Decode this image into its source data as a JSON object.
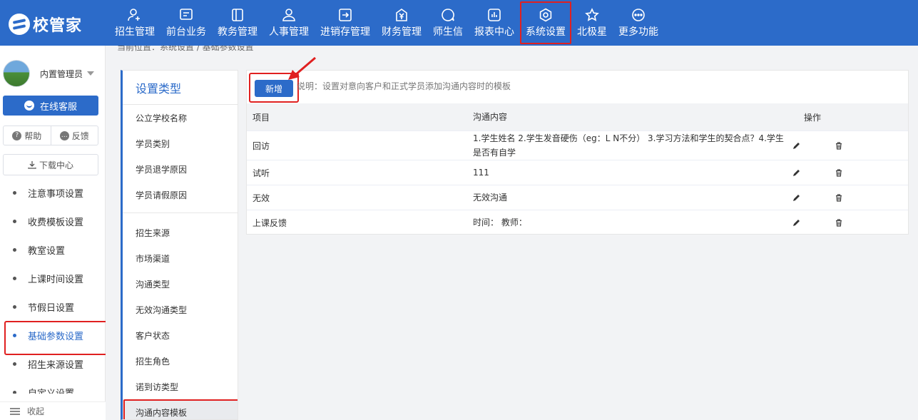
{
  "app": {
    "logo_text": "校管家"
  },
  "nav": [
    {
      "label": "招生管理",
      "icon": "add-user-icon"
    },
    {
      "label": "前台业务",
      "icon": "monitor-icon"
    },
    {
      "label": "教务管理",
      "icon": "book-icon"
    },
    {
      "label": "人事管理",
      "icon": "person-icon"
    },
    {
      "label": "进销存管理",
      "icon": "inventory-icon"
    },
    {
      "label": "财务管理",
      "icon": "yuan-icon"
    },
    {
      "label": "师生信",
      "icon": "chat-icon"
    },
    {
      "label": "报表中心",
      "icon": "report-icon"
    },
    {
      "label": "系统设置",
      "icon": "settings-icon",
      "active": true
    },
    {
      "label": "北极星",
      "icon": "star-icon"
    },
    {
      "label": "更多功能",
      "icon": "more-icon"
    }
  ],
  "breadcrumb": "当前位置：系统设置 / 基础参数设置",
  "sidebar": {
    "user_name": "内置管理员",
    "service_label": "在线客服",
    "help_label": "帮助",
    "feedback_label": "反馈",
    "download_label": "下载中心",
    "menu": [
      {
        "label": "注意事项设置"
      },
      {
        "label": "收费模板设置"
      },
      {
        "label": "教室设置"
      },
      {
        "label": "上课时间设置"
      },
      {
        "label": "节假日设置"
      },
      {
        "label": "基础参数设置",
        "active": true
      },
      {
        "label": "招生来源设置"
      },
      {
        "label": "自定义设置"
      }
    ],
    "collapse_label": "收起"
  },
  "types": {
    "title": "设置类型",
    "group1": [
      "公立学校名称",
      "学员类别",
      "学员退学原因",
      "学员请假原因"
    ],
    "group2": [
      "招生来源",
      "市场渠道",
      "沟通类型",
      "无效沟通类型",
      "客户状态",
      "招生角色",
      "诺到访类型",
      "沟通内容模板"
    ],
    "active": "沟通内容模板"
  },
  "content": {
    "add_label": "新增",
    "hint": "说明：设置对意向客户和正式学员添加沟通内容时的模板",
    "columns": [
      "项目",
      "沟通内容",
      "操作"
    ],
    "rows": [
      {
        "item": "回访",
        "content": "1.学生姓名 2.学生发音硬伤（eg：L N不分） 3.学习方法和学生的契合点？4.学生是否有自学"
      },
      {
        "item": "试听",
        "content": "111"
      },
      {
        "item": "无效",
        "content": "无效沟通"
      },
      {
        "item": "上课反馈",
        "content": "时间： 教师："
      }
    ]
  },
  "colors": {
    "brand": "#2c6bc9",
    "highlight": "#e02020"
  }
}
